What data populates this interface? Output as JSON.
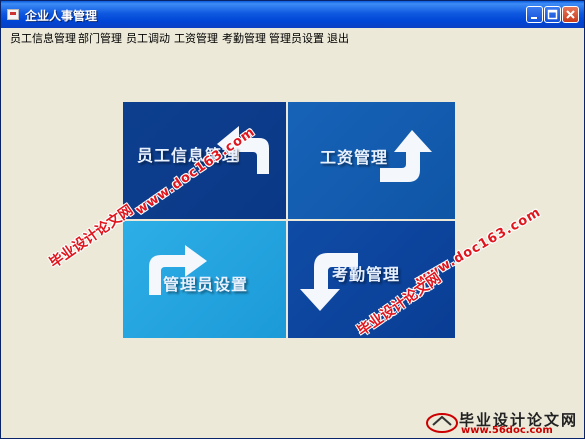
{
  "window": {
    "title": "企业人事管理"
  },
  "menu": {
    "items": [
      "员工信息管理",
      "部门管理",
      "员工调动",
      "工资管理",
      "考勤管理",
      "管理员设置",
      "退出"
    ]
  },
  "tiles": [
    {
      "label": "员工信息管理",
      "icon": "return-arrow-icon"
    },
    {
      "label": "工资管理",
      "icon": "up-arrow-icon"
    },
    {
      "label": "管理员设置",
      "icon": "right-arrow-icon"
    },
    {
      "label": "考勤管理",
      "icon": "down-arrow-icon"
    }
  ],
  "watermarks": {
    "cn": "毕业设计论文网",
    "url": "www.doc163.com",
    "corner_cn": "毕业设计论文网",
    "corner_site": "www.56doc.com"
  },
  "colors": {
    "titlebar": "#0054e3",
    "tile_dark": "#0a3886",
    "tile_mid": "#1763b8",
    "tile_light": "#2eaee6",
    "watermark": "#e0161e"
  }
}
